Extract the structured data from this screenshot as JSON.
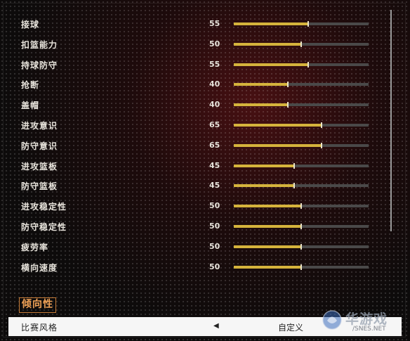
{
  "stats": [
    {
      "label": "接球",
      "value": "55",
      "level": 55
    },
    {
      "label": "扣篮能力",
      "value": "50",
      "level": 50
    },
    {
      "label": "持球防守",
      "value": "55",
      "level": 55
    },
    {
      "label": "抢断",
      "value": "40",
      "level": 40
    },
    {
      "label": "盖帽",
      "value": "40",
      "level": 40
    },
    {
      "label": "进攻意识",
      "value": "65",
      "level": 65
    },
    {
      "label": "防守意识",
      "value": "65",
      "level": 65
    },
    {
      "label": "进攻篮板",
      "value": "45",
      "level": 45
    },
    {
      "label": "防守篮板",
      "value": "45",
      "level": 45
    },
    {
      "label": "进攻稳定性",
      "value": "50",
      "level": 50
    },
    {
      "label": "防守稳定性",
      "value": "50",
      "level": 50
    },
    {
      "label": "疲劳率",
      "value": "50",
      "level": 50
    },
    {
      "label": "横向速度",
      "value": "50",
      "level": 50
    }
  ],
  "slider_max": 100,
  "section": {
    "title": "倾向性"
  },
  "style_row": {
    "label": "比赛风格",
    "value": "自定义",
    "arrow": "◀"
  },
  "watermark": {
    "text": "华游戏",
    "url": "/SNES.NET"
  },
  "colors": {
    "slider_fill": "#d5b33c",
    "slider_track": "#4a4949",
    "section_accent": "#f0a257",
    "selected_row_bg": "#f6f6f6"
  }
}
